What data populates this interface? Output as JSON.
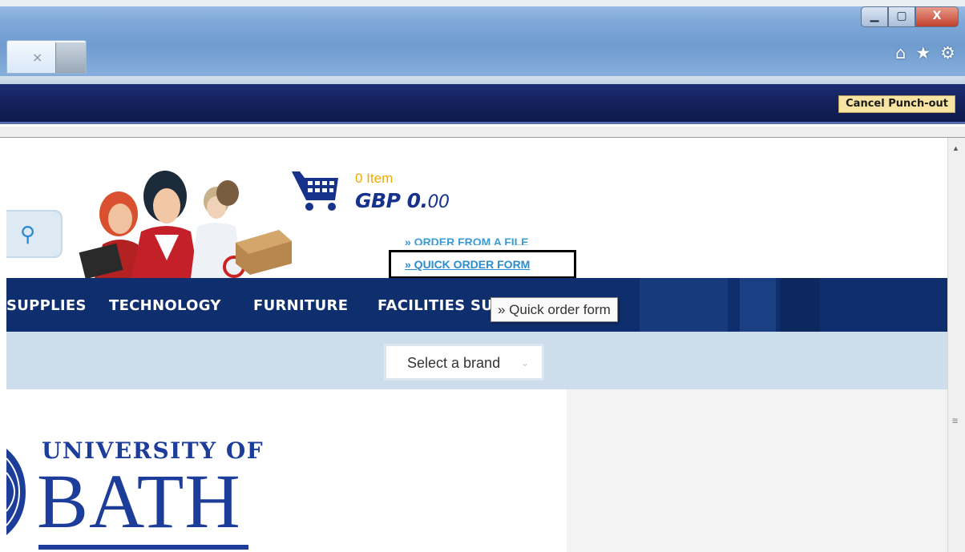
{
  "window": {
    "tab_close_glyph": "×",
    "min_glyph": "▁",
    "max_glyph": "▢",
    "close_glyph": "X",
    "icons": [
      "home-icon",
      "favorites-star-icon",
      "settings-gear-icon"
    ],
    "home_glyph": "⌂",
    "star_glyph": "★",
    "gear_glyph": "⚙"
  },
  "punchout": {
    "cancel_label": "Cancel Punch-out"
  },
  "header": {
    "search_glyph": "⚲",
    "cart": {
      "count_text": "0 Item",
      "total_currency": "GBP 0.",
      "total_decimals": "00"
    },
    "links": {
      "order_from_file": "» ORDER FROM A FILE",
      "quick_order_form": "» QUICK ORDER FORM"
    }
  },
  "nav": {
    "items": [
      "SUPPLIES",
      "TECHNOLOGY",
      "FURNITURE",
      "FACILITIES SU"
    ],
    "tooltip": "» Quick order form"
  },
  "brand_filter": {
    "selected": "Select a brand",
    "caret": "⌄"
  },
  "logo": {
    "top_line": "UNIVERSITY OF",
    "main_line": "BATH"
  },
  "scrollbar": {
    "up_glyph": "▲",
    "grip_glyph": "≡"
  },
  "colors": {
    "navy": "#0f2e6e",
    "accent_blue": "#2b8cd0",
    "cart_orange": "#f2a800",
    "logo_blue": "#1c3e9a"
  }
}
